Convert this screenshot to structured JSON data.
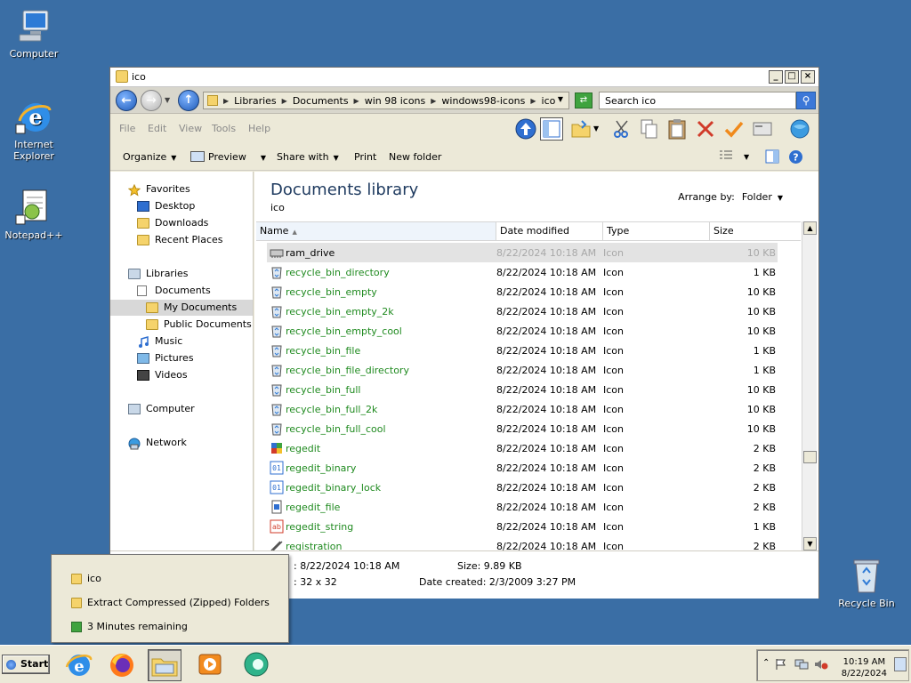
{
  "desktop": {
    "icons": [
      {
        "label": "Computer"
      },
      {
        "label": "Internet Explorer"
      },
      {
        "label": "Notepad++"
      },
      {
        "label": "Recycle Bin"
      }
    ]
  },
  "window": {
    "title": "ico",
    "address": [
      "Libraries",
      "Documents",
      "win 98 icons",
      "windows98-icons",
      "ico"
    ],
    "search_placeholder": "Search ico",
    "menu": [
      "File",
      "Edit",
      "View",
      "Tools",
      "Help"
    ],
    "commands": {
      "organize": "Organize",
      "preview": "Preview",
      "share_with": "Share with",
      "print": "Print",
      "new_folder": "New folder"
    },
    "nav": {
      "favorites": "Favorites",
      "desktop": "Desktop",
      "downloads": "Downloads",
      "recent": "Recent Places",
      "libraries": "Libraries",
      "documents": "Documents",
      "my_documents": "My Documents",
      "public_documents": "Public Documents",
      "music": "Music",
      "pictures": "Pictures",
      "videos": "Videos",
      "computer": "Computer",
      "network": "Network"
    },
    "library_title": "Documents library",
    "library_sub": "ico",
    "arrange_label": "Arrange by:",
    "arrange_value": "Folder",
    "columns": {
      "name": "Name",
      "date": "Date modified",
      "type": "Type",
      "size": "Size"
    },
    "files": [
      {
        "name": "ram_drive",
        "date": "8/22/2024 10:18 AM",
        "type": "Icon",
        "size": "10 KB"
      },
      {
        "name": "recycle_bin_directory",
        "date": "8/22/2024 10:18 AM",
        "type": "Icon",
        "size": "1 KB"
      },
      {
        "name": "recycle_bin_empty",
        "date": "8/22/2024 10:18 AM",
        "type": "Icon",
        "size": "10 KB"
      },
      {
        "name": "recycle_bin_empty_2k",
        "date": "8/22/2024 10:18 AM",
        "type": "Icon",
        "size": "10 KB"
      },
      {
        "name": "recycle_bin_empty_cool",
        "date": "8/22/2024 10:18 AM",
        "type": "Icon",
        "size": "10 KB"
      },
      {
        "name": "recycle_bin_file",
        "date": "8/22/2024 10:18 AM",
        "type": "Icon",
        "size": "1 KB"
      },
      {
        "name": "recycle_bin_file_directory",
        "date": "8/22/2024 10:18 AM",
        "type": "Icon",
        "size": "1 KB"
      },
      {
        "name": "recycle_bin_full",
        "date": "8/22/2024 10:18 AM",
        "type": "Icon",
        "size": "10 KB"
      },
      {
        "name": "recycle_bin_full_2k",
        "date": "8/22/2024 10:18 AM",
        "type": "Icon",
        "size": "10 KB"
      },
      {
        "name": "recycle_bin_full_cool",
        "date": "8/22/2024 10:18 AM",
        "type": "Icon",
        "size": "10 KB"
      },
      {
        "name": "regedit",
        "date": "8/22/2024 10:18 AM",
        "type": "Icon",
        "size": "2 KB"
      },
      {
        "name": "regedit_binary",
        "date": "8/22/2024 10:18 AM",
        "type": "Icon",
        "size": "2 KB"
      },
      {
        "name": "regedit_binary_lock",
        "date": "8/22/2024 10:18 AM",
        "type": "Icon",
        "size": "2 KB"
      },
      {
        "name": "regedit_file",
        "date": "8/22/2024 10:18 AM",
        "type": "Icon",
        "size": "2 KB"
      },
      {
        "name": "regedit_string",
        "date": "8/22/2024 10:18 AM",
        "type": "Icon",
        "size": "1 KB"
      },
      {
        "name": "registration",
        "date": "8/22/2024 10:18 AM",
        "type": "Icon",
        "size": "2 KB"
      }
    ],
    "details": {
      "date_modified": ": 8/22/2024 10:18 AM",
      "dimensions": ": 32 x 32",
      "size": "Size: 9.89 KB",
      "date_created": "Date created: 2/3/2009 3:27 PM"
    }
  },
  "popup": {
    "items": [
      "ico",
      "Extract Compressed (Zipped) Folders",
      "3 Minutes remaining"
    ]
  },
  "taskbar": {
    "start_label": "Start",
    "time": "10:19 AM",
    "date": "8/22/2024"
  },
  "colors": {
    "desktop": "#3a6ea5",
    "file_name": "#1f8a1f",
    "window_bg": "#ece9d8"
  }
}
